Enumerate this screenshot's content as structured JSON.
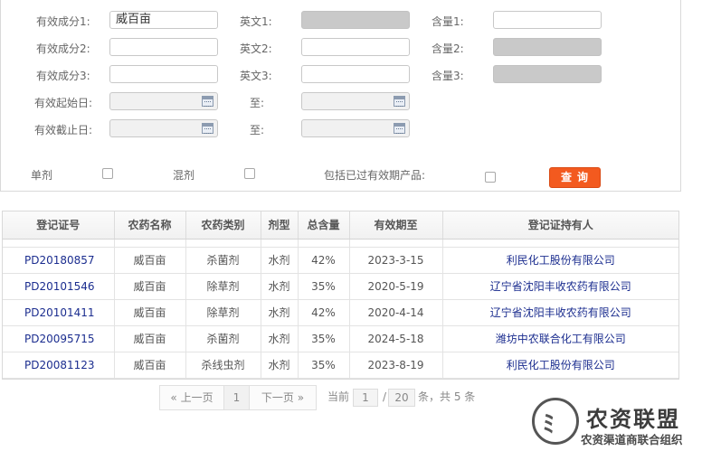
{
  "form": {
    "row1": {
      "label": "有效成分1:",
      "value": "威百亩",
      "en_label": "英文1:",
      "en_value": "",
      "content_label": "含量1:",
      "content_value": ""
    },
    "row2": {
      "label": "有效成分2:",
      "value": "",
      "en_label": "英文2:",
      "en_value": "",
      "content_label": "含量2:",
      "content_value": ""
    },
    "row3": {
      "label": "有效成分3:",
      "value": "",
      "en_label": "英文3:",
      "en_value": "",
      "content_label": "含量3:",
      "content_value": ""
    },
    "start": {
      "label": "有效起始日:",
      "to_label": "至:",
      "value": "",
      "to_value": ""
    },
    "end": {
      "label": "有效截止日:",
      "to_label": "至:",
      "value": "",
      "to_value": ""
    },
    "options": {
      "single_label": "单剂",
      "mixed_label": "混剂",
      "expired_label": "包括已过有效期产品:"
    },
    "query_label": "查询"
  },
  "table": {
    "headers": [
      "登记证号",
      "农药名称",
      "农药类别",
      "剂型",
      "总含量",
      "有效期至",
      "登记证持有人"
    ],
    "rows": [
      {
        "reg_no": "PD20180857",
        "name": "威百亩",
        "category": "杀菌剂",
        "form": "水剂",
        "content": "42%",
        "expiry": "2023-3-15",
        "holder": "利民化工股份有限公司"
      },
      {
        "reg_no": "PD20101546",
        "name": "威百亩",
        "category": "除草剂",
        "form": "水剂",
        "content": "35%",
        "expiry": "2020-5-19",
        "holder": "辽宁省沈阳丰收农药有限公司"
      },
      {
        "reg_no": "PD20101411",
        "name": "威百亩",
        "category": "除草剂",
        "form": "水剂",
        "content": "42%",
        "expiry": "2020-4-14",
        "holder": "辽宁省沈阳丰收农药有限公司"
      },
      {
        "reg_no": "PD20095715",
        "name": "威百亩",
        "category": "杀菌剂",
        "form": "水剂",
        "content": "35%",
        "expiry": "2024-5-18",
        "holder": "潍坊中农联合化工有限公司"
      },
      {
        "reg_no": "PD20081123",
        "name": "威百亩",
        "category": "杀线虫剂",
        "form": "水剂",
        "content": "35%",
        "expiry": "2023-8-19",
        "holder": "利民化工股份有限公司"
      }
    ]
  },
  "pager": {
    "prev": "« 上一页",
    "current": "1",
    "next": "下一页 »",
    "current_label": "当前",
    "page_value": "1",
    "separator": "/",
    "total_pages": "20",
    "total_text": "条，共 5 条"
  },
  "watermark": {
    "title": "农资联盟",
    "subtitle": "农资渠道商联合组织",
    "logo_glyph": "ﾐ"
  }
}
